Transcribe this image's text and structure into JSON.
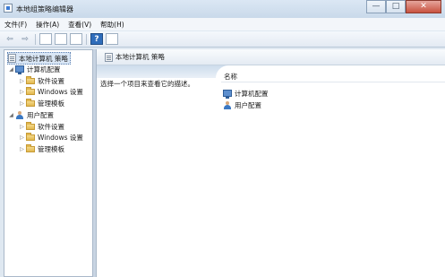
{
  "window": {
    "title": "本地组策略编辑器"
  },
  "window_controls": {
    "minimize": "—",
    "maximize": "□",
    "close": "✕"
  },
  "menu": [
    "文件(F)",
    "操作(A)",
    "查看(V)",
    "帮助(H)"
  ],
  "toolbar": {
    "icons": [
      "back-arrow-icon",
      "forward-arrow-icon",
      "show-tree-icon",
      "properties-icon",
      "export-icon",
      "help-icon",
      "view-icon"
    ],
    "back_glyph": "⇦",
    "forward_glyph": "⇨",
    "help_glyph": "?"
  },
  "tree": {
    "root": "本地计算机 策略",
    "computer": {
      "label": "计算机配置",
      "children": [
        "软件设置",
        "Windows 设置",
        "管理模板"
      ]
    },
    "user": {
      "label": "用户配置",
      "children": [
        "软件设置",
        "Windows 设置",
        "管理模板"
      ]
    }
  },
  "details": {
    "title": "本地计算机 策略",
    "description": "选择一个项目来查看它的描述。",
    "column_name": "名称",
    "items": [
      "计算机配置",
      "用户配置"
    ]
  },
  "glyphs": {
    "expanded": "◢",
    "collapsed": "▷"
  }
}
